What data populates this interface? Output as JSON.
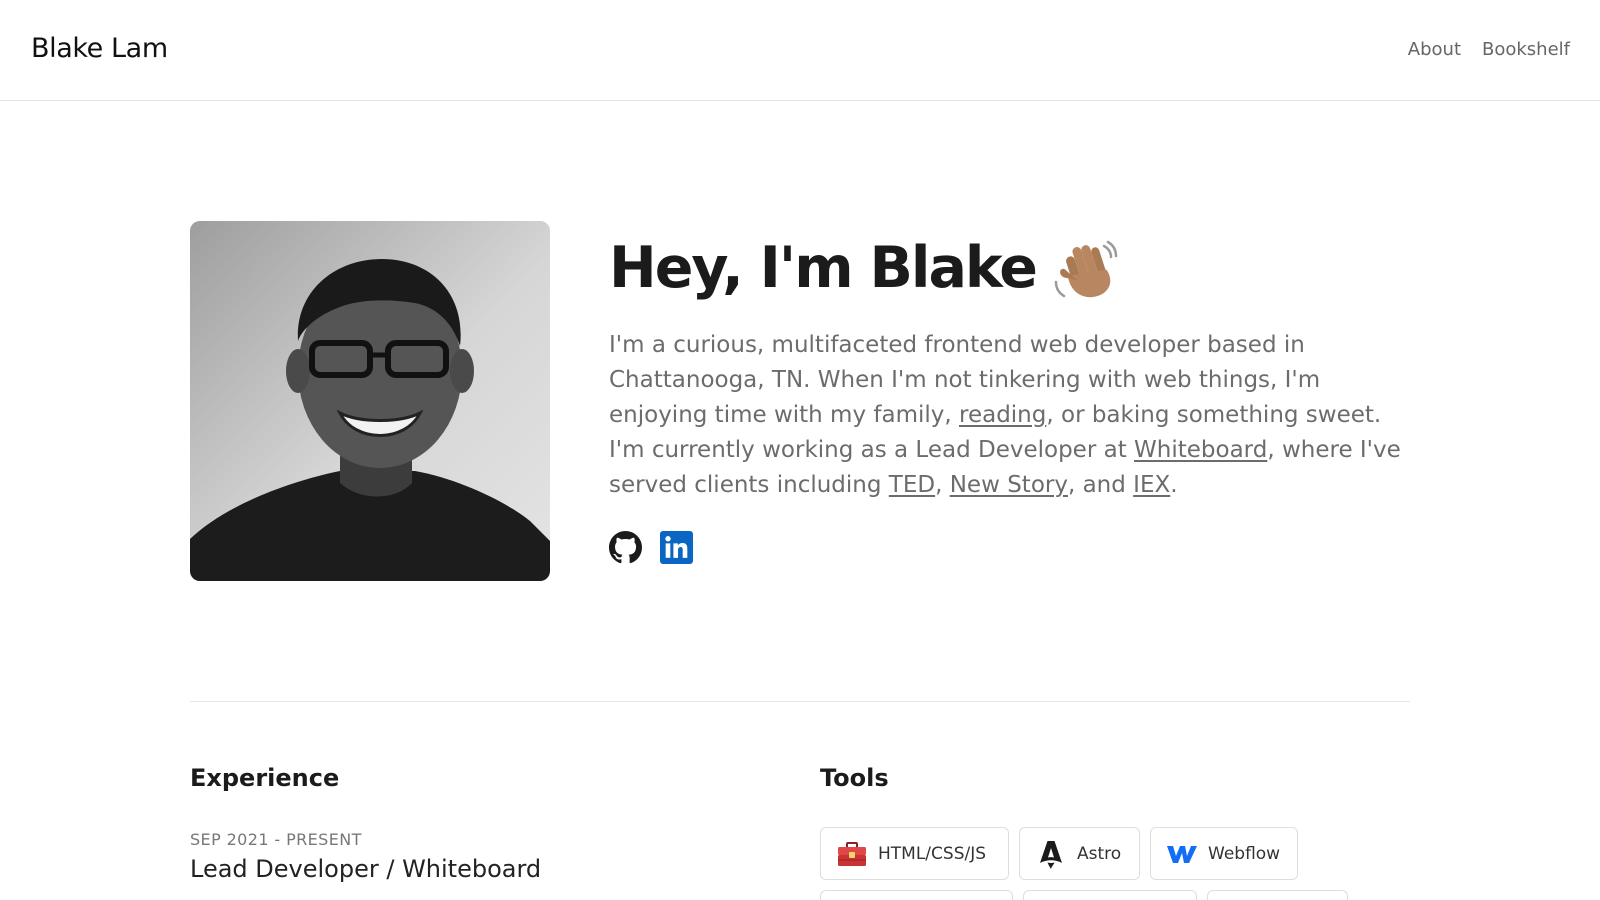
{
  "header": {
    "brand": "Blake Lam",
    "nav": [
      "About",
      "Bookshelf"
    ]
  },
  "hero": {
    "title": "Hey, I'm Blake",
    "wave_icon": "waving-hand-icon",
    "bio": {
      "t1": "I'm a curious, multifaceted frontend web developer based in Chattanooga, TN. When I'm not tinkering with web things, I'm enjoying time with my family, ",
      "link_reading": "reading",
      "t2": ", or baking something sweet. I'm currently working as a Lead Developer at ",
      "link_whiteboard": "Whiteboard",
      "t3": ", where I've served clients including ",
      "link_ted": "TED",
      "t4": ", ",
      "link_newstory": "New Story",
      "t5": ", and ",
      "link_iex": "IEX",
      "t6": "."
    },
    "socials": [
      "github-icon",
      "linkedin-icon"
    ]
  },
  "experience": {
    "title": "Experience",
    "items": [
      {
        "date": "SEP 2021 - PRESENT",
        "role": "Lead Developer / Whiteboard"
      }
    ]
  },
  "tools": {
    "title": "Tools",
    "items": [
      {
        "label": "HTML/CSS/JS",
        "icon": "toolbox-icon"
      },
      {
        "label": "Astro",
        "icon": "astro-icon"
      },
      {
        "label": "Webflow",
        "icon": "webflow-icon"
      }
    ]
  },
  "colors": {
    "text": "#1b1b1b",
    "muted": "#6c6c6c",
    "border": "#dedede",
    "linkedin": "#0a66c2",
    "webflow": "#146ef5",
    "toolbox": "#d63a3a"
  }
}
